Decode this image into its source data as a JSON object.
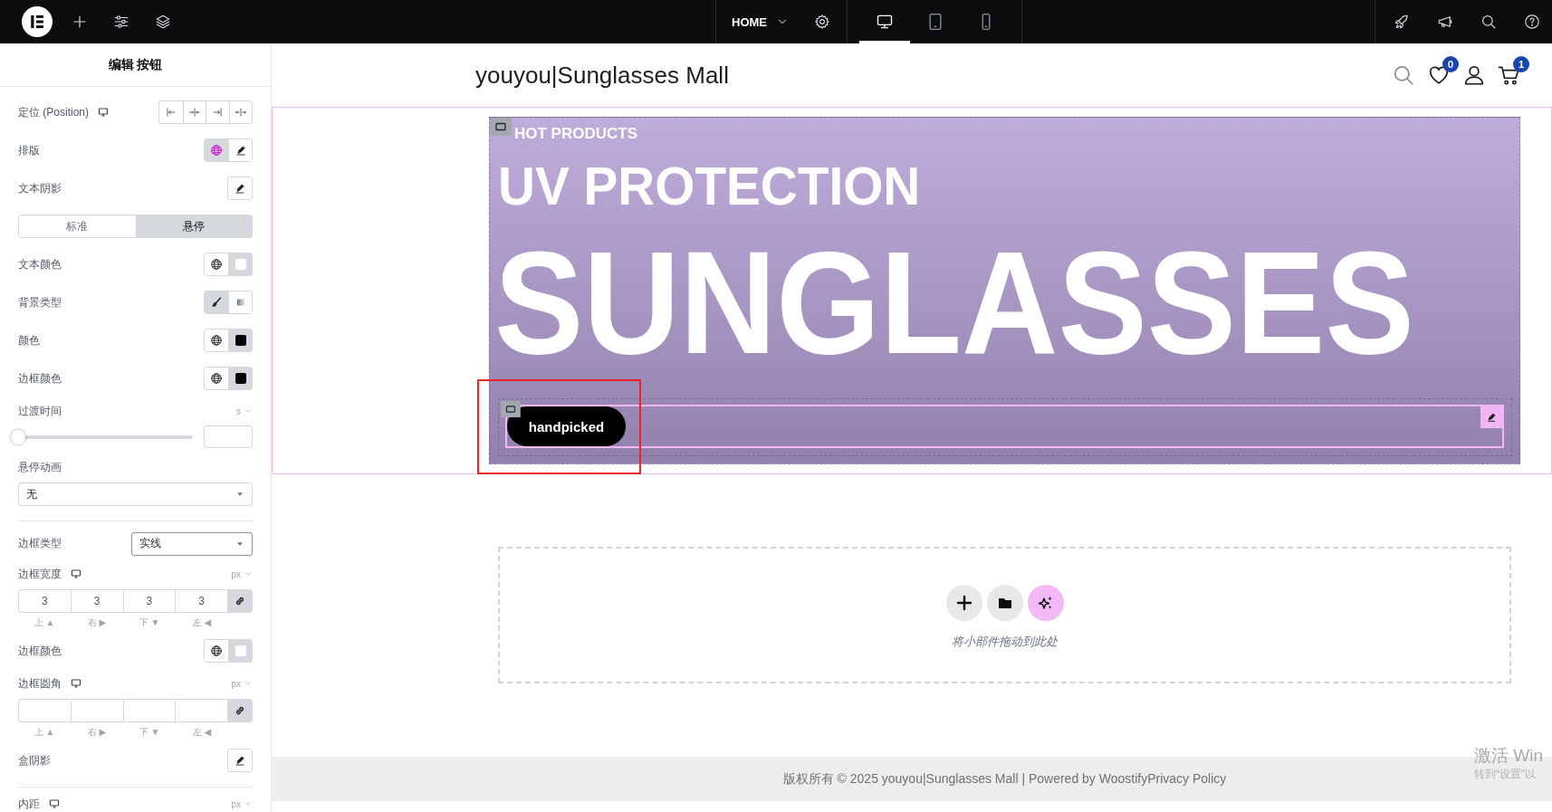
{
  "top_bar": {
    "page_menu": {
      "label": "HOME"
    },
    "devices": [
      {
        "kind": "desktop",
        "selected": true
      },
      {
        "kind": "tablet",
        "selected": false
      },
      {
        "kind": "mobile",
        "selected": false
      }
    ]
  },
  "panel": {
    "title": "编辑 按钮",
    "controls": [
      {
        "kind": "position",
        "label": "定位 (Position)"
      },
      {
        "kind": "popover",
        "label": "排版",
        "global_active": true
      },
      {
        "kind": "popover",
        "label": "文本阴影",
        "global_active": false
      },
      {
        "kind": "tabs",
        "tabs": [
          {
            "label": "标准",
            "selected": false
          },
          {
            "label": "悬停",
            "selected": true
          }
        ]
      },
      {
        "kind": "color",
        "label": "文本颜色",
        "color": "#ffffff"
      },
      {
        "kind": "background",
        "label": "背景类型",
        "options": [
          {
            "kind": "classic",
            "selected": true
          },
          {
            "kind": "gradient",
            "selected": false
          }
        ]
      },
      {
        "kind": "color",
        "label": "颜色",
        "color": "#000000"
      },
      {
        "kind": "color",
        "label": "边框颜色",
        "color": "#000000"
      },
      {
        "kind": "slider",
        "label": "过渡时间",
        "unit": "s",
        "level": 0
      },
      {
        "kind": "select_full",
        "label": "悬停动画",
        "value": "无"
      },
      {
        "kind": "divider"
      },
      {
        "kind": "select_inline",
        "label": "边框类型",
        "value": "实线"
      },
      {
        "kind": "dimensions",
        "label": "边框宽度",
        "unit": "px",
        "values": [
          "3",
          "3",
          "3",
          "3"
        ],
        "sides": [
          "上 ▲",
          "右 ▶",
          "下 ▼",
          "左 ◀"
        ],
        "linked": true
      },
      {
        "kind": "color",
        "label": "边框颜色",
        "color": "#ffffff"
      },
      {
        "kind": "dimensions",
        "label": "边框圆角",
        "unit": "px",
        "sides": [
          "上 ▲",
          "右 ▶",
          "下 ▼",
          "左 ◀"
        ],
        "linked": true
      },
      {
        "kind": "popover",
        "label": "盒阴影",
        "global_active": false
      },
      {
        "kind": "divider"
      },
      {
        "kind": "dimensions",
        "label": "内距",
        "unit": "px"
      }
    ]
  },
  "site_header": {
    "title": "youyou|Sunglasses Mall",
    "wishlist_count": "0",
    "cart_count": "1"
  },
  "hero": {
    "eyebrow": "HOT PRODUCTS",
    "headline": "UV PROTECTION",
    "title": "SUNGLASSES",
    "button": "handpicked"
  },
  "drop_zone": {
    "hint": "将小部件拖动到此处"
  },
  "footer": {
    "text": "版权所有 © 2025 youyou|Sunglasses Mall | Powered by WoostifyPrivacy Policy"
  },
  "system_notice": {
    "lines": [
      "激活 Win",
      "转到“设置”以"
    ]
  }
}
